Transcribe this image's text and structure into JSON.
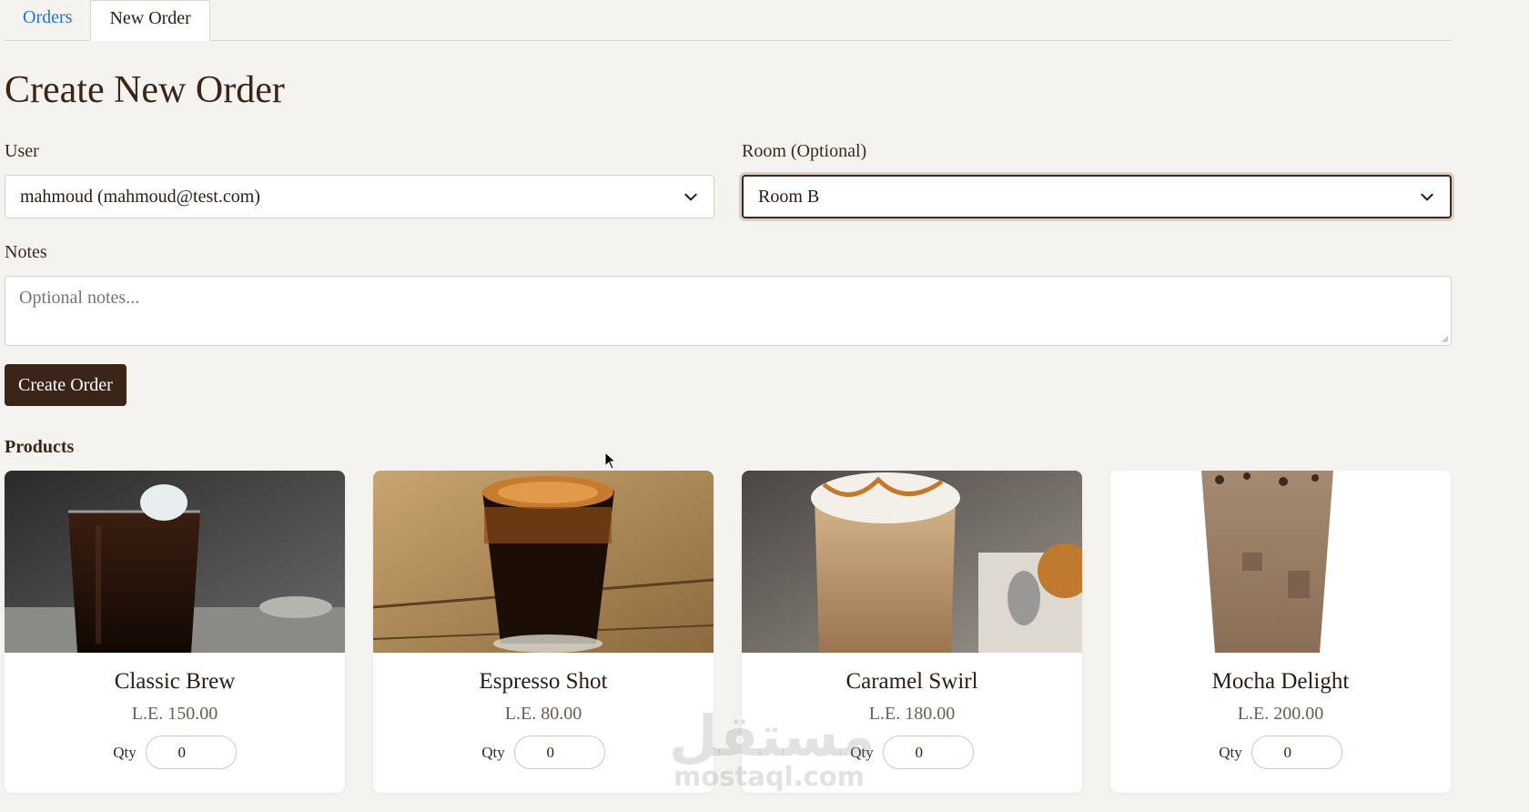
{
  "tabs": [
    {
      "label": "Orders"
    },
    {
      "label": "New Order"
    }
  ],
  "page_title": "Create New Order",
  "form": {
    "user_label": "User",
    "user_value": "mahmoud (mahmoud@test.com)",
    "room_label": "Room (Optional)",
    "room_value": "Room B",
    "notes_label": "Notes",
    "notes_placeholder": "Optional notes...",
    "submit_label": "Create Order"
  },
  "products_title": "Products",
  "products": [
    {
      "name": "Classic Brew",
      "price": "L.E. 150.00",
      "qty_label": "Qty",
      "qty": "0"
    },
    {
      "name": "Espresso Shot",
      "price": "L.E. 80.00",
      "qty_label": "Qty",
      "qty": "0"
    },
    {
      "name": "Caramel Swirl",
      "price": "L.E. 180.00",
      "qty_label": "Qty",
      "qty": "0"
    },
    {
      "name": "Mocha Delight",
      "price": "L.E. 200.00",
      "qty_label": "Qty",
      "qty": "0"
    }
  ],
  "watermark": {
    "arabic": "مستقل",
    "latin": "mostaql.com"
  },
  "colors": {
    "accent_button": "#3b2418",
    "tab_link": "#1a73e8",
    "background": "#f5f3ef"
  }
}
